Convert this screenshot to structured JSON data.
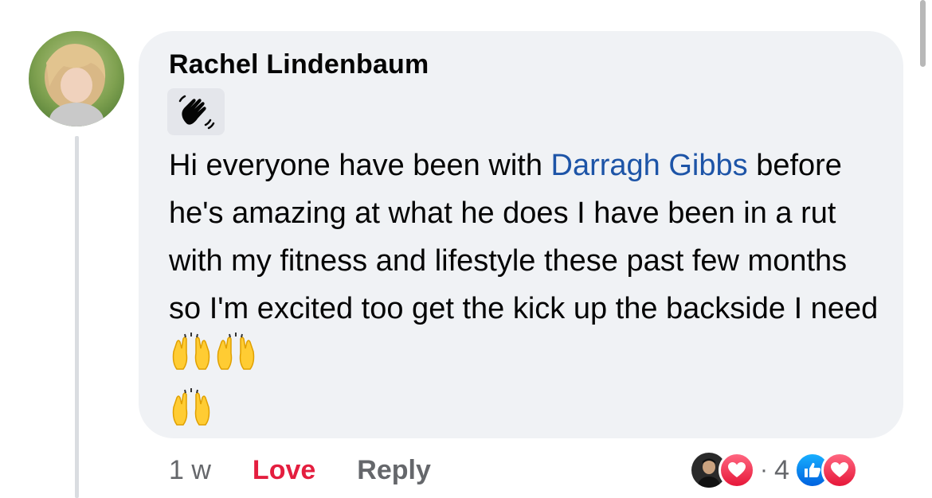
{
  "comment": {
    "author": "Rachel Lindenbaum",
    "badge_icon": "waving-hand-icon",
    "text_before_mention": "Hi everyone have been with ",
    "mention": "Darragh Gibbs",
    "text_after_mention": " before he's amazing at what he does I have been in a rut with my fitness and lifestyle these past few months so I'm excited too get the kick up the backside I need",
    "trailing_emoji": [
      "raising-hands-emoji",
      "raising-hands-emoji",
      "raising-hands-emoji"
    ]
  },
  "actions": {
    "timestamp": "1 w",
    "love_label": "Love",
    "reply_label": "Reply"
  },
  "reactions": {
    "count": "4",
    "separator": "·",
    "icons": [
      "love-reaction-icon",
      "like-reaction-icon",
      "love-reaction-icon"
    ]
  },
  "colors": {
    "bubble": "#f0f2f5",
    "mention": "#1d54a7",
    "love": "#e41e3f",
    "muted": "#65676b"
  }
}
